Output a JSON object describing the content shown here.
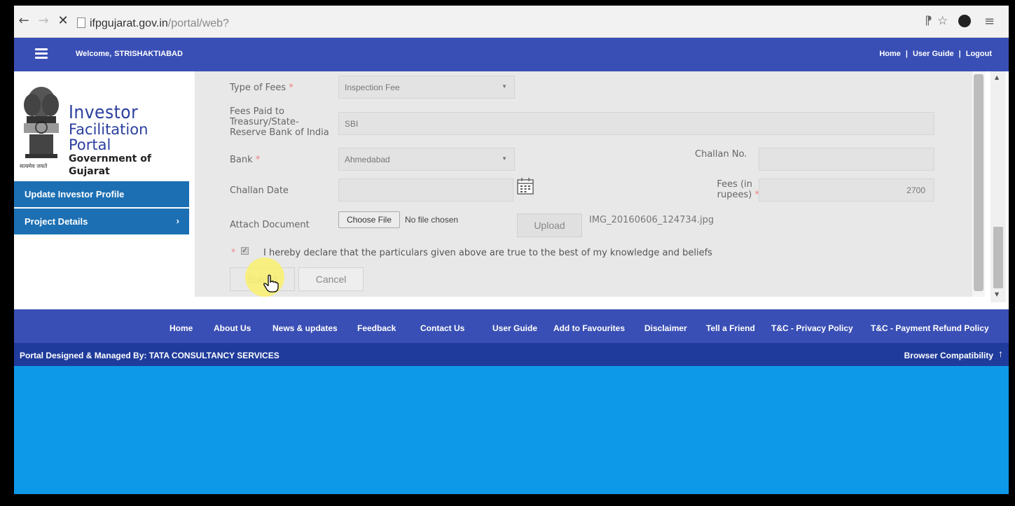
{
  "browser": {
    "url_host": "ifpgujarat.gov.in",
    "url_path": "/portal/web?"
  },
  "header": {
    "welcome_label": "Welcome,",
    "username": "STRISHAKTIABAD",
    "links": [
      "Home",
      "User Guide",
      "Logout"
    ],
    "color": "#3a4fb5"
  },
  "logo": {
    "line1": "Investor",
    "line2": "Facilitation Portal",
    "line3": "Government of Gujarat",
    "motto": "सत्यमेव जयते"
  },
  "sidebar": {
    "items": [
      {
        "label": "Update Investor Profile"
      },
      {
        "label": "Project Details",
        "chevron": "›"
      }
    ],
    "color": "#1c6fb3"
  },
  "form": {
    "type_of_fees_label": "Type of Fees",
    "type_of_fees_value": "Inspection Fee",
    "fees_paid_label_1": "Fees Paid to",
    "fees_paid_label_2": "Treasury/State-",
    "fees_paid_label_3": "Reserve Bank of India",
    "fees_paid_value": "SBI",
    "bank_label": "Bank",
    "bank_value": "Ahmedabad",
    "challan_no_label": "Challan No.",
    "challan_no_value": "",
    "challan_date_label": "Challan Date",
    "challan_date_value": "",
    "fees_label_1": "Fees (in",
    "fees_label_2": "rupees)",
    "fees_value": "2700",
    "attach_label": "Attach Document",
    "choose_file_label": "Choose File",
    "no_file_text": "No file chosen",
    "upload_label": "Upload",
    "uploaded_file": "IMG_20160606_124734.jpg",
    "declaration": "I hereby declare that the particulars given above are true to the best of my knowledge and beliefs",
    "declaration_checked": true,
    "submit_label": "Submit",
    "cancel_label": "Cancel",
    "required_mark": "*"
  },
  "footer": {
    "links": [
      "Home",
      "About Us",
      "News & updates",
      "Feedback",
      "Contact Us",
      "User Guide",
      "Add to Favourites",
      "Disclaimer",
      "Tell a Friend",
      "T&C - Privacy Policy",
      "T&C - Payment Refund Policy"
    ],
    "credit": "Portal Designed & Managed By: TATA CONSULTANCY SERVICES",
    "compat": "Browser Compatibility",
    "up_arrow": "↑"
  },
  "icons": {
    "back": "back-arrow-icon",
    "forward": "forward-arrow-icon",
    "stop": "close-icon",
    "menu": "hamburger-icon",
    "calendar": "calendar-icon",
    "cursor": "hand-pointer-icon"
  }
}
